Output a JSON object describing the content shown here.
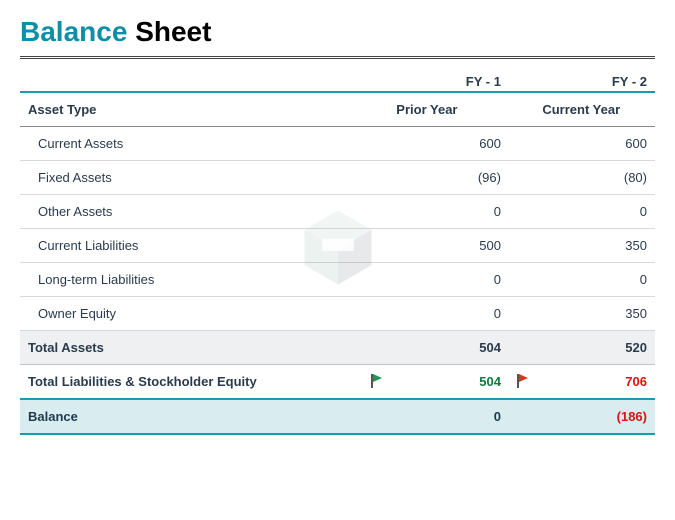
{
  "title": {
    "part1": "Balance",
    "part2": "Sheet"
  },
  "header": {
    "fy1": "FY - 1",
    "fy2": "FY - 2",
    "asset_type": "Asset Type",
    "prior_year": "Prior Year",
    "current_year": "Current Year"
  },
  "rows": [
    {
      "label": "Current Assets",
      "prior": "600",
      "current": "600",
      "prior_neg": false,
      "current_neg": false
    },
    {
      "label": "Fixed Assets",
      "prior": "(96)",
      "current": "(80)",
      "prior_neg": true,
      "current_neg": true
    },
    {
      "label": "Other Assets",
      "prior": "0",
      "current": "0",
      "prior_neg": false,
      "current_neg": false
    },
    {
      "label": "Current Liabilities",
      "prior": "500",
      "current": "350",
      "prior_neg": false,
      "current_neg": false
    },
    {
      "label": "Long-term Liabilities",
      "prior": "0",
      "current": "0",
      "prior_neg": false,
      "current_neg": false
    },
    {
      "label": "Owner Equity",
      "prior": "0",
      "current": "350",
      "prior_neg": false,
      "current_neg": false
    }
  ],
  "totals": {
    "assets": {
      "label": "Total Assets",
      "prior": "504",
      "current": "520"
    },
    "equity": {
      "label": "Total Liabilities & Stockholder Equity",
      "prior": "504",
      "current": "706",
      "flag_prior": "green",
      "flag_current": "red"
    },
    "balance": {
      "label": "Balance",
      "prior": "0",
      "current": "(186)",
      "current_neg": true
    }
  },
  "chart_data": {
    "type": "table",
    "title": "Balance Sheet",
    "columns": [
      "Asset Type",
      "Prior Year (FY - 1)",
      "Current Year (FY - 2)"
    ],
    "rows": [
      [
        "Current Assets",
        600,
        600
      ],
      [
        "Fixed Assets",
        -96,
        -80
      ],
      [
        "Other Assets",
        0,
        0
      ],
      [
        "Current Liabilities",
        500,
        350
      ],
      [
        "Long-term Liabilities",
        0,
        0
      ],
      [
        "Owner Equity",
        0,
        350
      ],
      [
        "Total Assets",
        504,
        520
      ],
      [
        "Total Liabilities & Stockholder Equity",
        504,
        706
      ],
      [
        "Balance",
        0,
        -186
      ]
    ]
  }
}
